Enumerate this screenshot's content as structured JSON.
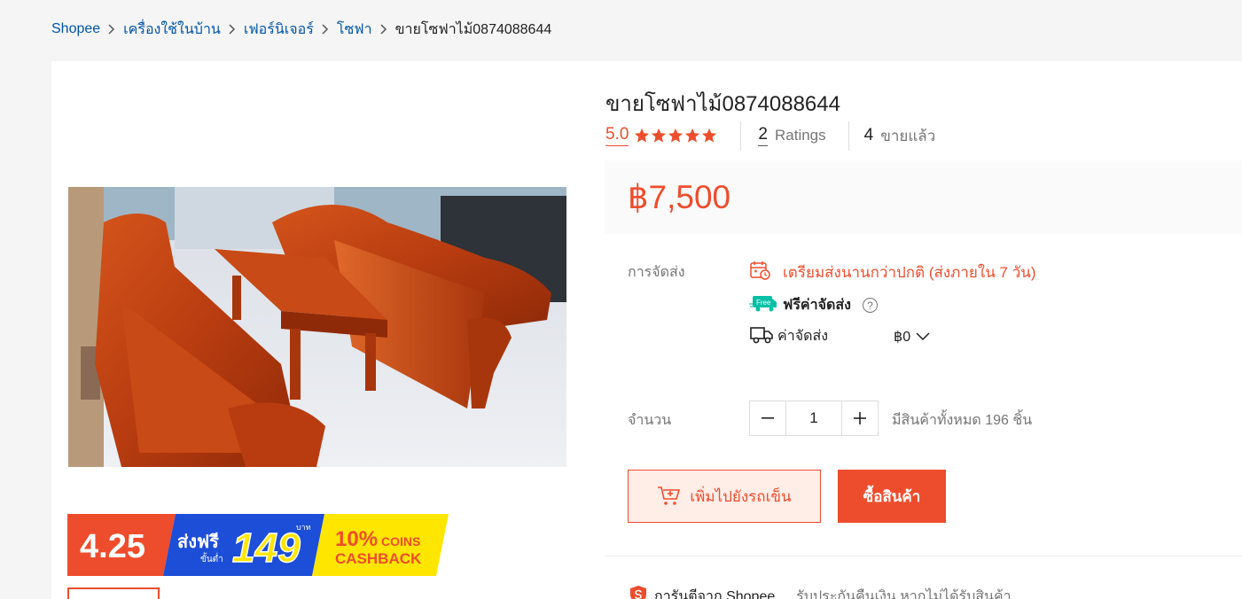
{
  "breadcrumb": {
    "items": [
      "Shopee",
      "เครื่องใช้ในบ้าน",
      "เฟอร์นิเจอร์",
      "โซฟา"
    ],
    "current": "ขายโซฟาไม้0874088644"
  },
  "product": {
    "title": "ขายโซฟาไม้0874088644",
    "rating": "5.0",
    "star_count": 5,
    "ratings_count": "2",
    "ratings_label": "Ratings",
    "sold_count": "4",
    "sold_label": "ขายแล้ว",
    "price": "฿7,500"
  },
  "promo": {
    "date": "4.25",
    "free_ship": "ส่งฟรี",
    "min_label": "ขั้นต่ำ",
    "min_amount": "149",
    "baht": "บาท",
    "coins_pct": "10%",
    "coins": "COINS",
    "cashback": "CASHBACK"
  },
  "shipping": {
    "label": "การจัดส่ง",
    "late_notice": "เตรียมส่งนานกว่าปกติ (ส่งภายใน 7 วัน)",
    "free_badge": "Free",
    "free_label": "ฟรีค่าจัดส่ง",
    "help": "?",
    "fee_label": "ค่าจัดส่ง",
    "fee_value": "฿0"
  },
  "quantity": {
    "label": "จำนวน",
    "value": "1",
    "stock": "มีสินค้าทั้งหมด 196 ชิ้น"
  },
  "actions": {
    "add_to_cart": "เพิ่มไปยังรถเข็น",
    "buy_now": "ซื้อสินค้า"
  },
  "guarantee": {
    "title": "การันตีจาก Shopee",
    "description": "รับประกันคืนเงิน หากไม่ได้รับสินค้า"
  },
  "colors": {
    "accent": "#ee4d2d",
    "link": "#0055aa",
    "free_green": "#00bfa5"
  }
}
